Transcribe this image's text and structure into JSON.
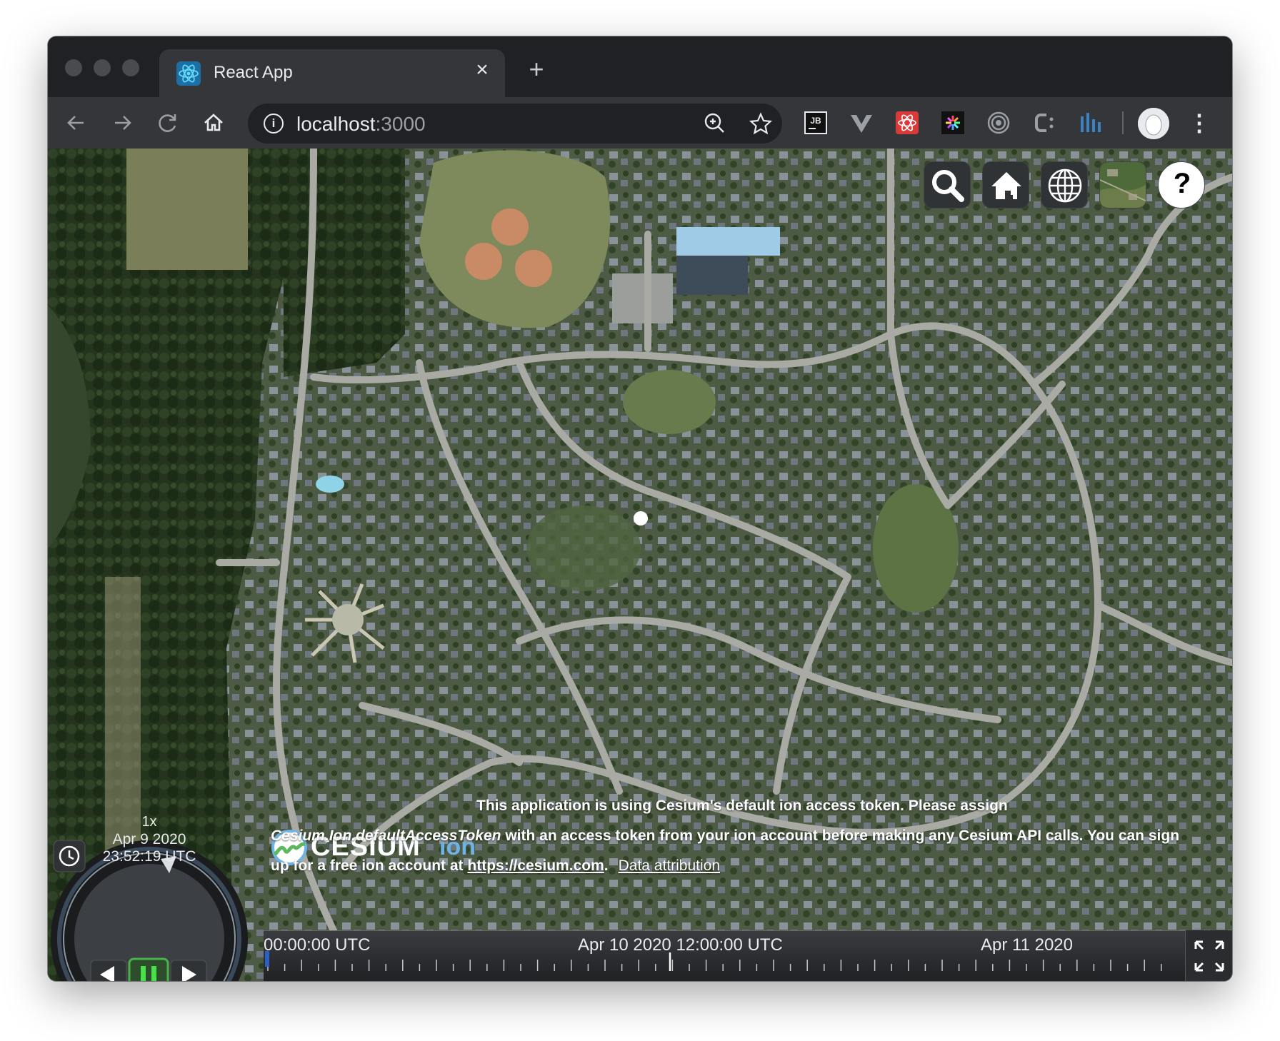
{
  "browser": {
    "tab_title": "React App",
    "tab_close": "×",
    "new_tab": "+",
    "url_host": "localhost",
    "url_port": ":3000",
    "menu": "⋮"
  },
  "cesium_toolbar": {
    "help_label": "?"
  },
  "credits": {
    "logo_text_main": "CESIUM",
    "logo_text_ion": "ion",
    "line1": "This application is using Cesium's default ion access token. Please assign",
    "line2_code": "Cesium.Ion.defaultAccessToken",
    "line2_rest": " with an access token from your ion account before making any Cesium API calls. You can sign",
    "line3_start": "up for a free ion account at ",
    "line3_link": "https://cesium.com",
    "line3_end": ".",
    "data_attribution": "Data attribution"
  },
  "animation": {
    "speed": "1x",
    "date": "Apr 9 2020",
    "time": "23:52:19 UTC"
  },
  "timeline": {
    "label_start": "00:00:00 UTC",
    "label_mid": "Apr 10 2020 12:00:00 UTC",
    "label_end": "Apr 11 2020"
  },
  "colors": {
    "accent_green": "#48b348",
    "chrome_dark": "#202124",
    "chrome_toolbar": "#35363a"
  }
}
